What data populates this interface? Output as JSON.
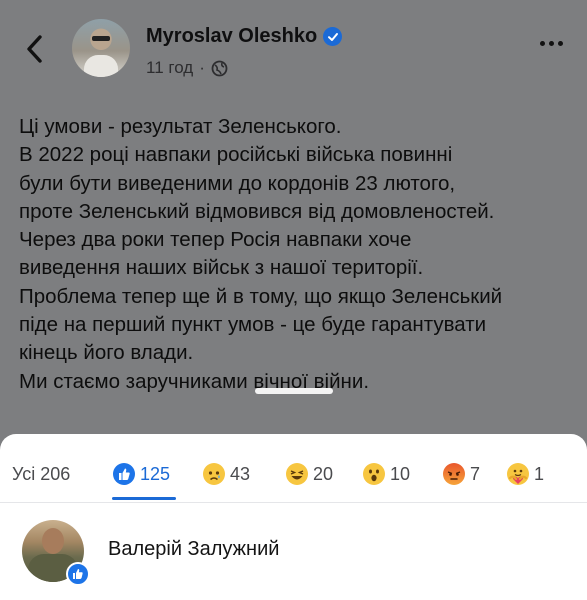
{
  "header": {
    "back_icon": "chevron-left-icon",
    "author": "Myroslav Oleshko",
    "time": "11 год",
    "separator": "·",
    "privacy_icon": "globe-icon",
    "more_icon": "more-horizontal-icon"
  },
  "post": {
    "lines": [
      "Ці умови - результат Зеленського.",
      "В 2022 році навпаки російські війська повинні",
      "були бути виведеними до кордонів 23 лютого,",
      "проте Зеленський відмовився від домовленостей.",
      "Через два роки тепер Росія навпаки хоче",
      "виведення наших військ з нашої території.",
      "Проблема тепер ще й в тому, що якщо Зеленський",
      "піде на перший пункт умов - це буде гарантувати",
      "кінець його влади.",
      "Ми стаємо заручниками вічної війни."
    ]
  },
  "reactions": {
    "tabs": [
      {
        "label": "Усі 206",
        "icon": ""
      },
      {
        "label": "125",
        "icon": "like-icon"
      },
      {
        "label": "43",
        "icon": "sad-icon"
      },
      {
        "label": "20",
        "icon": "haha-icon"
      },
      {
        "label": "10",
        "icon": "wow-icon"
      },
      {
        "label": "7",
        "icon": "angry-icon"
      },
      {
        "label": "1",
        "icon": "care-icon"
      }
    ],
    "active_tab": 1
  },
  "list": {
    "items": [
      {
        "name": "Валерій Залужний",
        "reaction": "like-icon"
      }
    ]
  },
  "colors": {
    "accent": "#1b6ad6",
    "overlay": "#7d7e80",
    "sheet": "#ffffff"
  }
}
